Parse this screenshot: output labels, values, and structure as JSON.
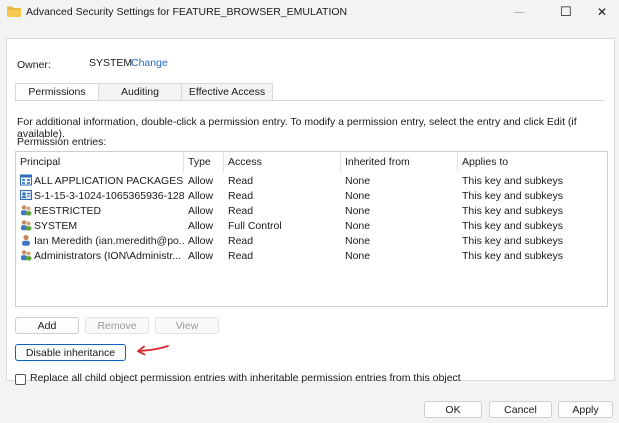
{
  "window": {
    "title": "Advanced Security Settings for FEATURE_BROWSER_EMULATION",
    "controls": {
      "minimize": "—",
      "maximize": "☐",
      "close": "✕"
    }
  },
  "owner": {
    "label": "Owner:",
    "value": "SYSTEM",
    "change_link": "Change"
  },
  "tabs": [
    {
      "label": "Permissions",
      "active": true
    },
    {
      "label": "Auditing",
      "active": false
    },
    {
      "label": "Effective Access",
      "active": false
    }
  ],
  "info_text": "For additional information, double-click a permission entry. To modify a permission entry, select the entry and click Edit (if available).",
  "entries_label": "Permission entries:",
  "table": {
    "columns": [
      "Principal",
      "Type",
      "Access",
      "Inherited from",
      "Applies to"
    ],
    "rows": [
      {
        "icon": "app-package-icon",
        "principal": "ALL APPLICATION PACKAGES",
        "type": "Allow",
        "access": "Read",
        "inherited": "None",
        "applies": "This key and subkeys"
      },
      {
        "icon": "sid-icon",
        "principal": "S-1-15-3-1024-1065365936-1281...",
        "type": "Allow",
        "access": "Read",
        "inherited": "None",
        "applies": "This key and subkeys"
      },
      {
        "icon": "group-icon",
        "principal": "RESTRICTED",
        "type": "Allow",
        "access": "Read",
        "inherited": "None",
        "applies": "This key and subkeys"
      },
      {
        "icon": "group-icon",
        "principal": "SYSTEM",
        "type": "Allow",
        "access": "Full Control",
        "inherited": "None",
        "applies": "This key and subkeys"
      },
      {
        "icon": "user-icon",
        "principal": "Ian Meredith (ian.meredith@po...",
        "type": "Allow",
        "access": "Read",
        "inherited": "None",
        "applies": "This key and subkeys"
      },
      {
        "icon": "group-icon",
        "principal": "Administrators (ION\\Administr...",
        "type": "Allow",
        "access": "Read",
        "inherited": "None",
        "applies": "This key and subkeys"
      }
    ]
  },
  "buttons": {
    "add": "Add",
    "remove": "Remove",
    "view": "View",
    "disable_inheritance": "Disable inheritance",
    "ok": "OK",
    "cancel": "Cancel",
    "apply": "Apply"
  },
  "checkbox_label": "Replace all child object permission entries with inheritable permission entries from this object",
  "colors": {
    "link": "#1b6ac9",
    "annotation_arrow": "#d9262a",
    "focus_border": "#0a64c8"
  }
}
